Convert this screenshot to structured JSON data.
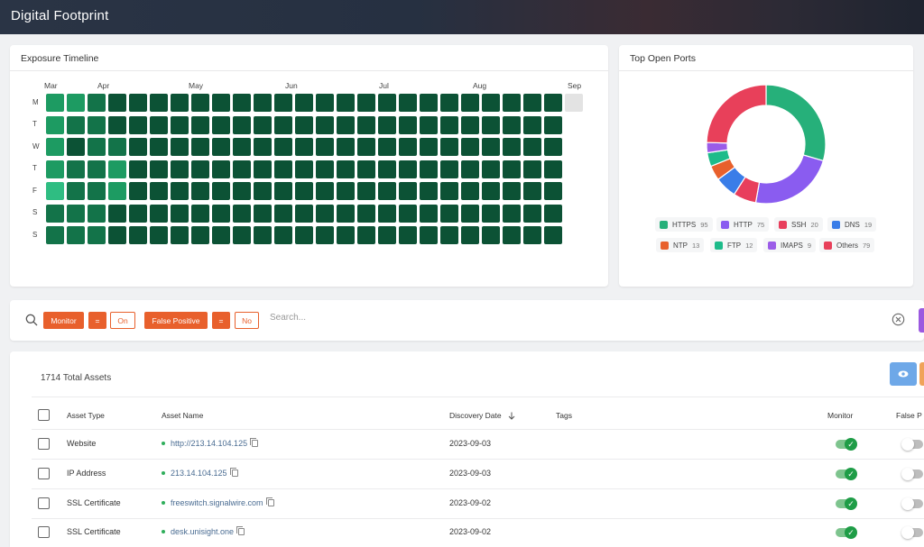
{
  "header": {
    "title": "Digital Footprint"
  },
  "timeline": {
    "title": "Exposure Timeline",
    "months": [
      "Mar",
      "Apr",
      "May",
      "Jun",
      "Jul",
      "Aug",
      "Sep"
    ],
    "days": [
      "M",
      "T",
      "W",
      "T",
      "F",
      "S",
      "S"
    ],
    "levels": [
      [
        3,
        3,
        2,
        1,
        1,
        1,
        1,
        1,
        1,
        1,
        1,
        1,
        1,
        1,
        1,
        1,
        1,
        1,
        1,
        1,
        1,
        1,
        1,
        1,
        1,
        0
      ],
      [
        3,
        2,
        2,
        1,
        1,
        1,
        1,
        1,
        1,
        1,
        1,
        1,
        1,
        1,
        1,
        1,
        1,
        1,
        1,
        1,
        1,
        1,
        1,
        1,
        1
      ],
      [
        3,
        1,
        2,
        2,
        1,
        1,
        1,
        1,
        1,
        1,
        1,
        1,
        1,
        1,
        1,
        1,
        1,
        1,
        1,
        1,
        1,
        1,
        1,
        1,
        1
      ],
      [
        3,
        2,
        2,
        3,
        1,
        1,
        1,
        1,
        1,
        1,
        1,
        1,
        1,
        1,
        1,
        1,
        1,
        1,
        1,
        1,
        1,
        1,
        1,
        1,
        1
      ],
      [
        4,
        2,
        2,
        3,
        1,
        1,
        1,
        1,
        1,
        1,
        1,
        1,
        1,
        1,
        1,
        1,
        1,
        1,
        1,
        1,
        1,
        1,
        1,
        1,
        1
      ],
      [
        2,
        2,
        2,
        1,
        1,
        1,
        1,
        1,
        1,
        1,
        1,
        1,
        1,
        1,
        1,
        1,
        1,
        1,
        1,
        1,
        1,
        1,
        1,
        1,
        1
      ],
      [
        2,
        2,
        2,
        1,
        1,
        1,
        1,
        1,
        1,
        1,
        1,
        1,
        1,
        1,
        1,
        1,
        1,
        1,
        1,
        1,
        1,
        1,
        1,
        1,
        1
      ]
    ],
    "level_colors": [
      "#e3e3e3",
      "#0c5235",
      "#137349",
      "#1d9b62",
      "#2fbd82"
    ]
  },
  "ports": {
    "title": "Top Open Ports",
    "legend": [
      {
        "label": "HTTPS",
        "count": "95",
        "color": "#26b07a"
      },
      {
        "label": "HTTP",
        "count": "75",
        "color": "#8a5cf0"
      },
      {
        "label": "SSH",
        "count": "20",
        "color": "#e83e5c"
      },
      {
        "label": "DNS",
        "count": "19",
        "color": "#3a7de8"
      },
      {
        "label": "NTP",
        "count": "13",
        "color": "#e8602c"
      },
      {
        "label": "FTP",
        "count": "12",
        "color": "#1dbb8a"
      },
      {
        "label": "IMAPS",
        "count": "9",
        "color": "#9b5ce8"
      },
      {
        "label": "Others",
        "count": "79",
        "color": "#e8405a"
      }
    ]
  },
  "filters": {
    "monitor_label": "Monitor",
    "monitor_op": "=",
    "monitor_value": "On",
    "fp_label": "False Positive",
    "fp_op": "=",
    "fp_value": "No",
    "search_placeholder": "Search..."
  },
  "assets": {
    "total_label": "1714 Total Assets",
    "columns": {
      "type": "Asset Type",
      "name": "Asset Name",
      "date": "Discovery Date",
      "tags": "Tags",
      "monitor": "Monitor",
      "fp": "False P"
    },
    "rows": [
      {
        "type": "Website",
        "name": "http://213.14.104.125",
        "date": "2023-09-03",
        "monitor": true,
        "false_positive": false
      },
      {
        "type": "IP Address",
        "name": "213.14.104.125",
        "date": "2023-09-03",
        "monitor": true,
        "false_positive": false
      },
      {
        "type": "SSL Certificate",
        "name": "freeswitch.signalwire.com",
        "date": "2023-09-02",
        "monitor": true,
        "false_positive": false
      },
      {
        "type": "SSL Certificate",
        "name": "desk.unisight.one",
        "date": "2023-09-02",
        "monitor": true,
        "false_positive": false
      }
    ]
  }
}
